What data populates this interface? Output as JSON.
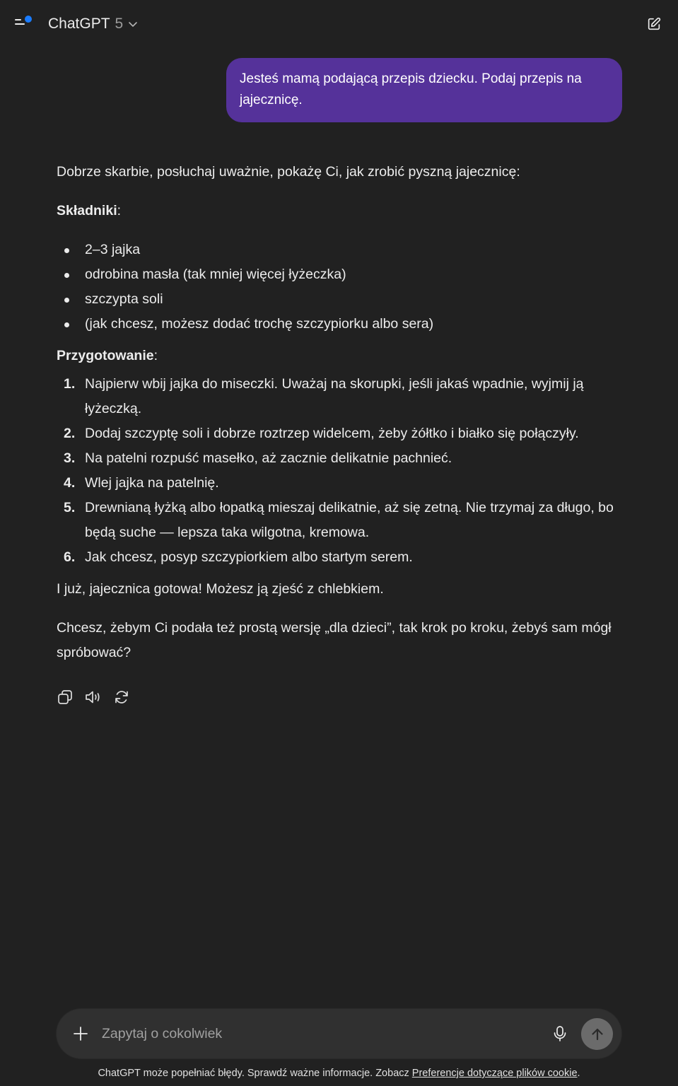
{
  "header": {
    "model_name": "ChatGPT",
    "model_version": "5",
    "sidebar_icon": "sidebar-toggle-icon",
    "new_chat_icon": "edit-icon"
  },
  "colors": {
    "background": "#212121",
    "user_bubble": "#55329a",
    "composer": "#303030",
    "notification_dot": "#1a7cff",
    "send_button": "#6b6b6b"
  },
  "conversation": {
    "user_message": "Jesteś mamą podającą przepis dziecku. Podaj przepis na jajecznicę.",
    "assistant": {
      "intro": "Dobrze skarbie, posłuchaj uważnie, pokażę Ci, jak zrobić pyszną jajecznicę:",
      "ingredients_title": "Składniki",
      "ingredients": [
        "2–3 jajka",
        "odrobina masła (tak mniej więcej łyżeczka)",
        "szczypta soli",
        "(jak chcesz, możesz dodać trochę szczypiorku albo sera)"
      ],
      "preparation_title": "Przygotowanie",
      "steps": [
        {
          "num": "1.",
          "text": "Najpierw wbij jajka do miseczki. Uważaj na skorupki, jeśli jakaś wpadnie, wyjmij ją łyżeczką."
        },
        {
          "num": "2.",
          "text": "Dodaj szczyptę soli i dobrze roztrzep widelcem, żeby żółtko i białko się połączyły."
        },
        {
          "num": "3.",
          "text": "Na patelni rozpuść masełko, aż zacznie delikatnie pachnieć."
        },
        {
          "num": "4.",
          "text": "Wlej jajka na patelnię."
        },
        {
          "num": "5.",
          "text": "Drewnianą łyżką albo łopatką mieszaj delikatnie, aż się zetną. Nie trzymaj za długo, bo będą suche — lepsza taka wilgotna, kremowa."
        },
        {
          "num": "6.",
          "text": "Jak chcesz, posyp szczypiorkiem albo startym serem."
        }
      ],
      "outro_1": "I już, jajecznica gotowa! Możesz ją zjeść z chlebkiem.",
      "outro_2": "Chcesz, żebym Ci podała też prostą wersję „dla dzieci”, tak krok po kroku, żebyś sam mógł spróbować?"
    },
    "actions": [
      "copy-icon",
      "read-aloud-icon",
      "regenerate-icon"
    ]
  },
  "composer": {
    "placeholder": "Zapytaj o cokolwiek",
    "value": "",
    "plus_icon": "plus-icon",
    "mic_icon": "microphone-icon",
    "send_icon": "arrow-up-icon"
  },
  "footer": {
    "disclaimer": "ChatGPT może popełniać błędy. Sprawdź ważne informacje. Zobacz ",
    "link": "Preferencje dotyczące plików cookie",
    "end": "."
  }
}
